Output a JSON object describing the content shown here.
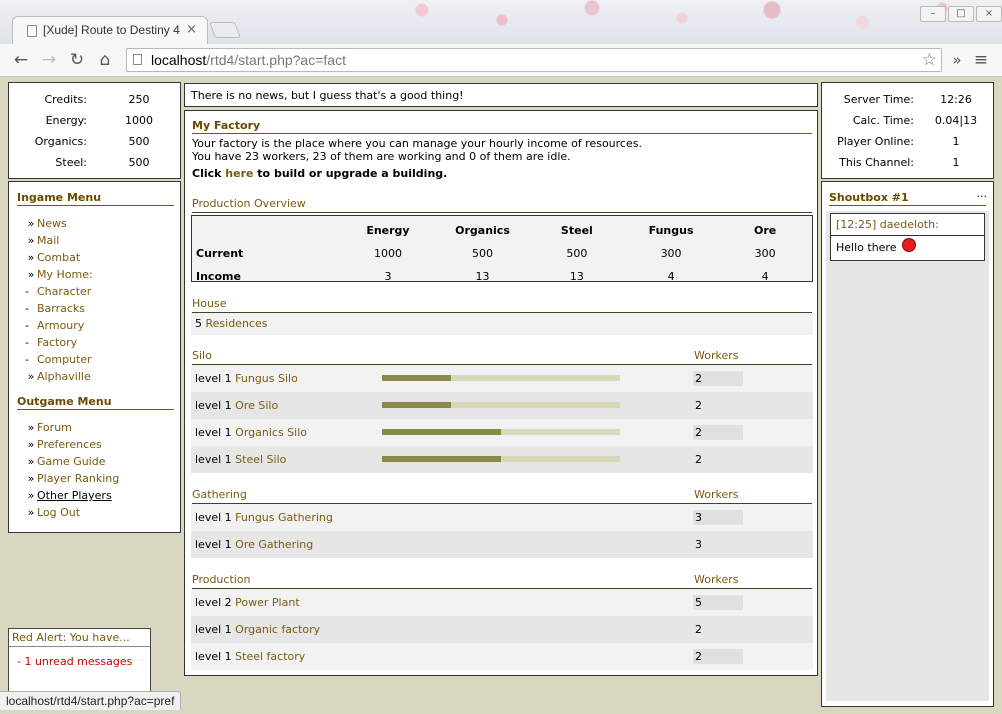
{
  "browser": {
    "tab_title": "[Xude] Route to Destiny 4",
    "tab_close": "×",
    "url_host": "localhost",
    "url_path": "/rtd4/start.php?ac=fact",
    "status_url": "localhost/rtd4/start.php?ac=pref"
  },
  "resources": [
    {
      "label": "Credits:",
      "value": "250"
    },
    {
      "label": "Energy:",
      "value": "1000"
    },
    {
      "label": "Organics:",
      "value": "500"
    },
    {
      "label": "Steel:",
      "value": "500"
    }
  ],
  "ingame_menu": {
    "title": "Ingame Menu",
    "items": [
      "News",
      "Mail",
      "Combat",
      "My Home:",
      "Character",
      "Barracks",
      "Armoury",
      "Factory",
      "Computer",
      "Alphaville"
    ]
  },
  "outgame_menu": {
    "title": "Outgame Menu",
    "items": [
      "Forum",
      "Preferences",
      "Game Guide",
      "Player Ranking",
      "Other Players",
      "Log Out"
    ]
  },
  "alert": {
    "title": "Red Alert: You have...",
    "message": "- 1 unread messages"
  },
  "news": "There is no news, but I guess that's a good thing!",
  "factory": {
    "title": "My Factory",
    "desc1": "Your factory is the place where you can manage your hourly income of resources.",
    "desc2": "You have 23 workers, 23 of them are working and 0 of them are idle.",
    "build_prefix": "Click ",
    "build_link": "here",
    "build_suffix": " to build or upgrade a building."
  },
  "production_overview": {
    "title": "Production Overview",
    "columns": [
      "Energy",
      "Organics",
      "Steel",
      "Fungus",
      "Ore"
    ],
    "rows": [
      {
        "label": "Current",
        "values": [
          "1000",
          "500",
          "500",
          "300",
          "300"
        ]
      },
      {
        "label": "Income",
        "values": [
          "3",
          "13",
          "13",
          "4",
          "4"
        ]
      }
    ]
  },
  "house": {
    "title": "House",
    "count": "5",
    "name": "Residences"
  },
  "silo": {
    "title": "Silo",
    "workers_label": "Workers",
    "rows": [
      {
        "level": "level 1",
        "name": "Fungus Silo",
        "fill": 0.29,
        "workers": "2"
      },
      {
        "level": "level 1",
        "name": "Ore Silo",
        "fill": 0.29,
        "workers": "2"
      },
      {
        "level": "level 1",
        "name": "Organics Silo",
        "fill": 0.5,
        "workers": "2"
      },
      {
        "level": "level 1",
        "name": "Steel Silo",
        "fill": 0.5,
        "workers": "2"
      }
    ]
  },
  "gathering": {
    "title": "Gathering",
    "workers_label": "Workers",
    "rows": [
      {
        "level": "level 1",
        "name": "Fungus Gathering",
        "workers": "3"
      },
      {
        "level": "level 1",
        "name": "Ore Gathering",
        "workers": "3"
      }
    ]
  },
  "production": {
    "title": "Production",
    "workers_label": "Workers",
    "rows": [
      {
        "level": "level 2",
        "name": "Power Plant",
        "workers": "5"
      },
      {
        "level": "level 1",
        "name": "Organic factory",
        "workers": "2"
      },
      {
        "level": "level 1",
        "name": "Steel factory",
        "workers": "2"
      }
    ]
  },
  "server": [
    {
      "label": "Server Time:",
      "value": "12:26"
    },
    {
      "label": "Calc. Time:",
      "value": "0.04|13"
    },
    {
      "label": "Player Online:",
      "value": "1"
    },
    {
      "label": "This Channel:",
      "value": "1"
    }
  ],
  "shoutbox": {
    "title": "Shoutbox #1",
    "more": "...",
    "time_user": "[12:25] daedeloth:",
    "message": "Hello there"
  },
  "colors": {
    "link": "#7a5a10",
    "header": "#6b4a00",
    "bar_fill": "#8a8a48",
    "bar_bg": "#d9d7ba",
    "alert": "#cc0000"
  }
}
